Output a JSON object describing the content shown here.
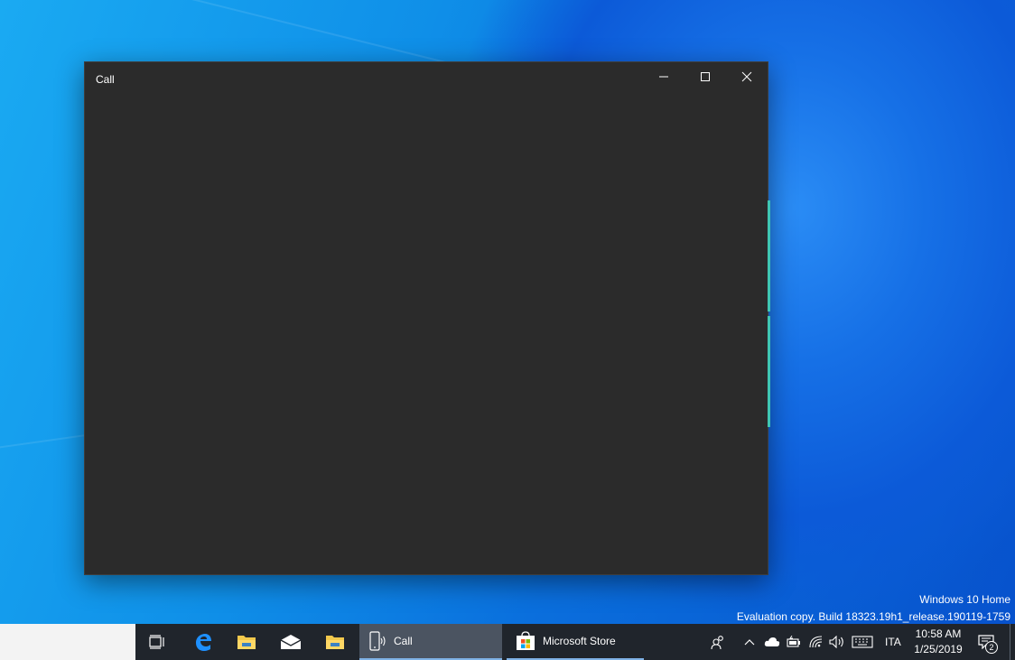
{
  "window": {
    "title": "Call",
    "controls": [
      "minimize",
      "maximize",
      "close"
    ]
  },
  "desktop": {
    "watermark_line1": "Windows 10 Home",
    "watermark_line2": "Evaluation copy. Build 18323.19h1_release.190119-1759"
  },
  "taskbar": {
    "pinned": [
      "task-view-icon",
      "edge-icon",
      "file-explorer-icon",
      "mail-icon",
      "file-explorer-icon"
    ],
    "apps": [
      {
        "label": "Call",
        "icon": "phone-icon",
        "active": true
      },
      {
        "label": "Microsoft Store",
        "icon": "store-icon",
        "active": false
      }
    ],
    "tray": {
      "language": "ITA",
      "time": "10:58 AM",
      "date": "1/25/2019",
      "notification_count": "2"
    }
  },
  "colors": {
    "window_bg": "#2b2b2b",
    "taskbar_bg": "#20252c",
    "accent": "#3fc6b4",
    "active_app_bg": "#4b5461"
  }
}
